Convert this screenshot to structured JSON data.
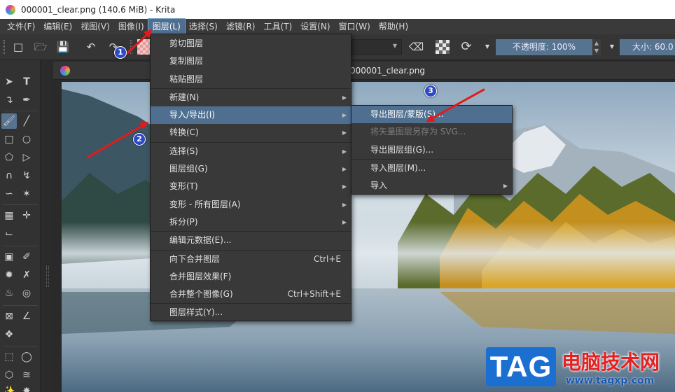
{
  "window": {
    "title": "000001_clear.png (140.6 MiB)  - Krita"
  },
  "menubar": {
    "items": [
      "文件(F)",
      "编辑(E)",
      "视图(V)",
      "图像(I)",
      "图层(L)",
      "选择(S)",
      "滤镜(R)",
      "工具(T)",
      "设置(N)",
      "窗口(W)",
      "帮助(H)"
    ],
    "active_index": 4
  },
  "toolbar": {
    "opacity_label": "不透明度: 100%",
    "size_label": "大小: 60.0"
  },
  "document_tab": {
    "title": "000001_clear.png"
  },
  "layer_menu": {
    "items": [
      {
        "label": "剪切图层",
        "shortcut": "",
        "submenu": false
      },
      {
        "label": "复制图层",
        "shortcut": "",
        "submenu": false
      },
      {
        "label": "粘贴图层",
        "shortcut": "",
        "submenu": false
      },
      {
        "label": "新建(N)",
        "shortcut": "",
        "submenu": true
      },
      {
        "label": "导入/导出(I)",
        "shortcut": "",
        "submenu": true,
        "highlighted": true
      },
      {
        "label": "转换(C)",
        "shortcut": "",
        "submenu": true
      },
      {
        "label": "选择(S)",
        "shortcut": "",
        "submenu": true
      },
      {
        "label": "图层组(G)",
        "shortcut": "",
        "submenu": true
      },
      {
        "label": "变形(T)",
        "shortcut": "",
        "submenu": true
      },
      {
        "label": "变形 - 所有图层(A)",
        "shortcut": "",
        "submenu": true
      },
      {
        "label": "拆分(P)",
        "shortcut": "",
        "submenu": true
      },
      {
        "label": "编辑元数据(E)...",
        "shortcut": "",
        "submenu": false
      },
      {
        "label": "向下合并图层",
        "shortcut": "Ctrl+E",
        "submenu": false
      },
      {
        "label": "合并图层效果(F)",
        "shortcut": "",
        "submenu": false
      },
      {
        "label": "合并整个图像(G)",
        "shortcut": "Ctrl+Shift+E",
        "submenu": false
      },
      {
        "label": "图层样式(Y)...",
        "shortcut": "",
        "submenu": false
      }
    ]
  },
  "import_export_submenu": {
    "items": [
      {
        "label": "导出图层/蒙版(S)...",
        "highlighted": true,
        "disabled": false,
        "submenu": false
      },
      {
        "label": "将矢量图层另存为 SVG...",
        "highlighted": false,
        "disabled": true,
        "submenu": false
      },
      {
        "label": "导出图层组(G)...",
        "highlighted": false,
        "disabled": false,
        "submenu": false
      },
      {
        "label": "导入图层(M)...",
        "highlighted": false,
        "disabled": false,
        "submenu": false
      },
      {
        "label": "导入",
        "highlighted": false,
        "disabled": false,
        "submenu": true
      }
    ]
  },
  "annotations": {
    "badges": [
      "1",
      "2",
      "3"
    ],
    "arrow_color": "#e21a1a",
    "badge_color": "#2e49c8"
  },
  "watermark": {
    "logo_text": "TAG",
    "title": "电脑技术网",
    "url": "www.tagxp.com"
  },
  "colors": {
    "menu_highlight": "#4f6f91",
    "opacity_box": "#56738f"
  }
}
